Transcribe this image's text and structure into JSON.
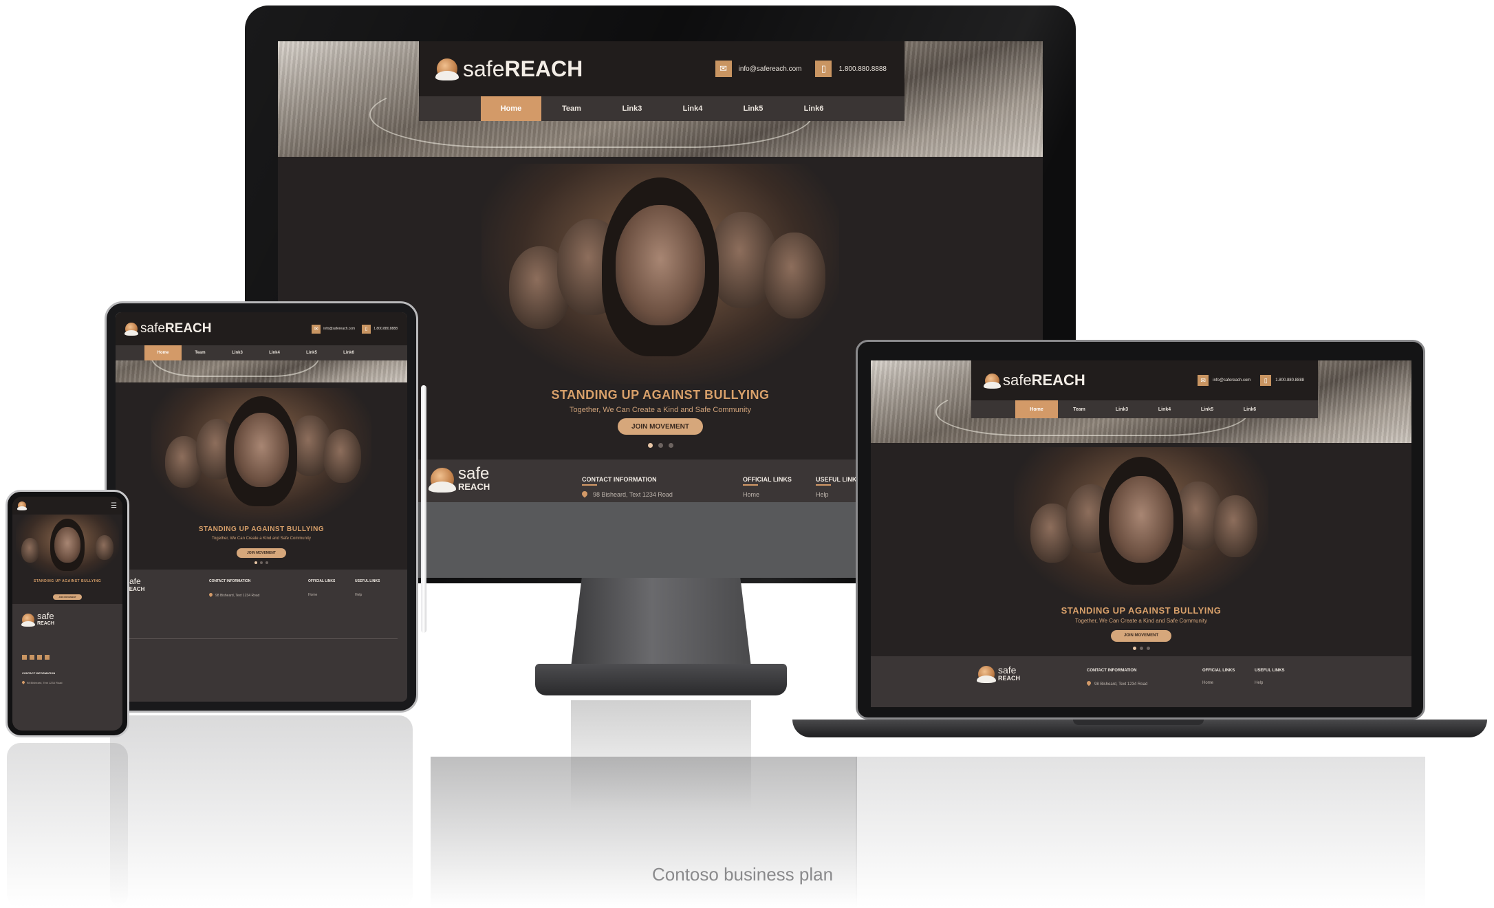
{
  "brand": {
    "logo_light": "safe",
    "logo_bold": "REACH",
    "footer_logo_top": "safe",
    "footer_logo_bottom": "REACH"
  },
  "header": {
    "email": "info@safereach.com",
    "phone": "1.800.880.8888"
  },
  "nav": {
    "items": [
      "Home",
      "Team",
      "Link3",
      "Link4",
      "Link5",
      "Link6"
    ],
    "active_index": 0
  },
  "hero": {
    "title": "STANDING UP AGAINST BULLYING",
    "subtitle": "Together, We Can Create a Kind and Safe Community",
    "button": "JOIN MOVEMENT",
    "slides": 3,
    "active_slide": 0
  },
  "footer": {
    "contact_heading": "CONTACT INFORMATION",
    "address": "98 Bisheard, Text 1234 Road",
    "official_heading": "OFFICIAL LINKS",
    "official_first": "Home",
    "useful_heading": "USEFUL LINKS",
    "useful_first": "Help"
  },
  "colors": {
    "accent": "#d39a68",
    "background": "#262222",
    "footer": "#3b3636"
  },
  "icons": {
    "email": "envelope-icon",
    "phone": "phone-icon",
    "location": "map-pin-icon"
  },
  "caption": "Contoso business plan"
}
